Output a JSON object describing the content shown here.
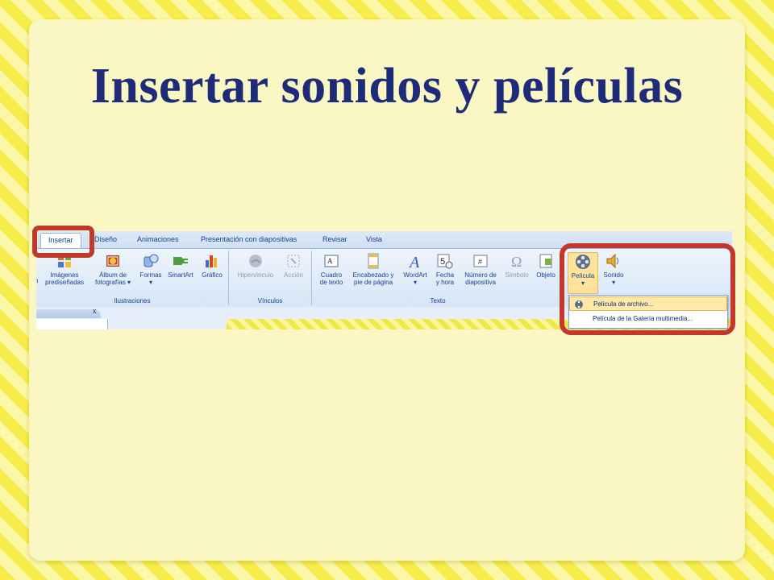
{
  "slide": {
    "title": "Insertar sonidos y películas"
  },
  "tabs": [
    {
      "label": "Insertar",
      "active": true
    },
    {
      "label": "Diseño"
    },
    {
      "label": "Animaciones"
    },
    {
      "label": "Presentación con diapositivas"
    },
    {
      "label": "Revisar"
    },
    {
      "label": "Vista"
    }
  ],
  "groups": {
    "ilustraciones": {
      "label": "Ilustraciones",
      "buttons": [
        {
          "line1": "Imágenes",
          "line2": "prediseñadas",
          "icon": "clipart-icon"
        },
        {
          "line1": "Álbum de",
          "line2": "fotografías ▾",
          "icon": "photo-album-icon"
        },
        {
          "line1": "Formas",
          "line2": "▾",
          "icon": "shapes-icon"
        },
        {
          "line1": "SmartArt",
          "line2": "",
          "icon": "smartart-icon"
        },
        {
          "line1": "Gráfico",
          "line2": "",
          "icon": "chart-icon"
        }
      ]
    },
    "vinculos": {
      "label": "Vínculos",
      "buttons": [
        {
          "line1": "Hipervínculo",
          "line2": "",
          "icon": "hyperlink-icon"
        },
        {
          "line1": "Acción",
          "line2": "",
          "icon": "action-icon"
        }
      ]
    },
    "texto": {
      "label": "Texto",
      "buttons": [
        {
          "line1": "Cuadro",
          "line2": "de texto",
          "icon": "textbox-icon"
        },
        {
          "line1": "Encabezado y",
          "line2": "pie de página",
          "icon": "header-footer-icon"
        },
        {
          "line1": "WordArt",
          "line2": "▾",
          "icon": "wordart-icon"
        },
        {
          "line1": "Fecha",
          "line2": "y hora",
          "icon": "date-time-icon"
        },
        {
          "line1": "Número de",
          "line2": "diapositiva",
          "icon": "slide-number-icon"
        },
        {
          "line1": "Símbolo",
          "line2": "",
          "icon": "symbol-icon"
        },
        {
          "line1": "Objeto",
          "line2": "",
          "icon": "object-icon"
        }
      ]
    },
    "media": {
      "buttons": [
        {
          "line1": "Película",
          "line2": "▾",
          "icon": "film-reel-icon"
        },
        {
          "line1": "Sonido",
          "line2": "▾",
          "icon": "speaker-icon"
        }
      ]
    }
  },
  "left_partial_label": "n",
  "pane_close": "x",
  "dropdown": {
    "items": [
      {
        "label": "Película de archivo...",
        "icon": "film-icon"
      },
      {
        "label": "Película de la Galería multimedia...",
        "icon": "gallery-film-icon"
      }
    ]
  },
  "colors": {
    "highlight": "#c0392b",
    "title": "#1d2b78",
    "ribbon_text": "#15428b"
  }
}
